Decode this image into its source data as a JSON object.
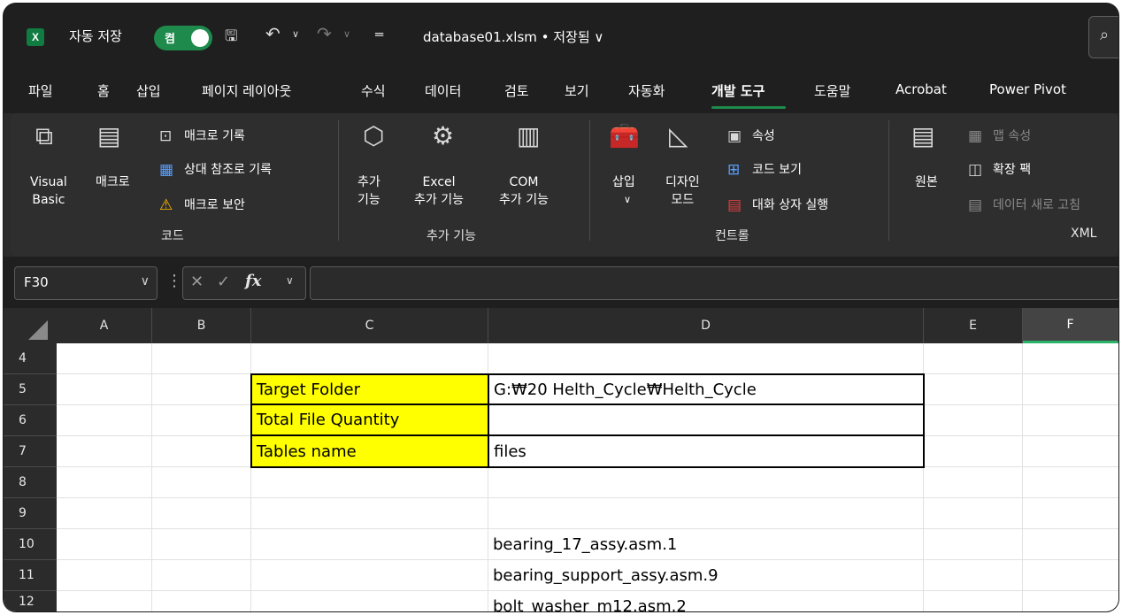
{
  "title_bar": {
    "app_icon": "X",
    "autosave_label": "자동 저장",
    "autosave_state": "켬",
    "file_title": "database01.xlsm • 저장됨 ∨",
    "save_icon": "save-icon",
    "undo_icon": "undo-icon",
    "redo_icon": "redo-icon"
  },
  "menu": {
    "tabs": [
      "파일",
      "홈",
      "삽입",
      "페이지 레이아웃",
      "수식",
      "데이터",
      "검토",
      "보기",
      "자동화",
      "개발 도구",
      "도움말",
      "Acrobat",
      "Power Pivot"
    ],
    "active": "개발 도구"
  },
  "ribbon": {
    "code": {
      "visual_basic": "Visual\nBasic",
      "macros": "매크로",
      "record_macro": "매크로 기록",
      "relative_ref": "상대 참조로 기록",
      "macro_security": "매크로 보안",
      "group": "코드"
    },
    "addins": {
      "addins": "추가\n기능",
      "excel_addins": "Excel\n추가 기능",
      "com_addins": "COM\n추가 기능",
      "group": "추가 기능"
    },
    "controls": {
      "insert": "삽입",
      "design_mode": "디자인\n모드",
      "properties": "속성",
      "view_code": "코드 보기",
      "run_dialog": "대화 상자 실행",
      "group": "컨트롤"
    },
    "xml": {
      "source": "원본",
      "map_properties": "맵 속성",
      "expansion_packs": "확장 팩",
      "refresh_data": "데이터 새로 고침",
      "group": "XML"
    }
  },
  "formula_bar": {
    "name_box": "F30",
    "formula": ""
  },
  "sheet": {
    "columns": [
      "A",
      "B",
      "C",
      "D",
      "E",
      "F"
    ],
    "selected_column": "F",
    "rows": [
      "4",
      "5",
      "6",
      "7",
      "8",
      "9",
      "10",
      "11",
      "12"
    ],
    "cells": {
      "C5": "Target Folder",
      "D5": "G:₩20 Helth_Cycle₩Helth_Cycle",
      "C6": "Total File Quantity",
      "D6": "",
      "C7": "Tables name",
      "D7": "files",
      "D10": "bearing_17_assy.asm.1",
      "D11": "bearing_support_assy.asm.9",
      "D12": "bolt_washer_m12.asm.2"
    },
    "highlight_color": "#ffff00"
  }
}
